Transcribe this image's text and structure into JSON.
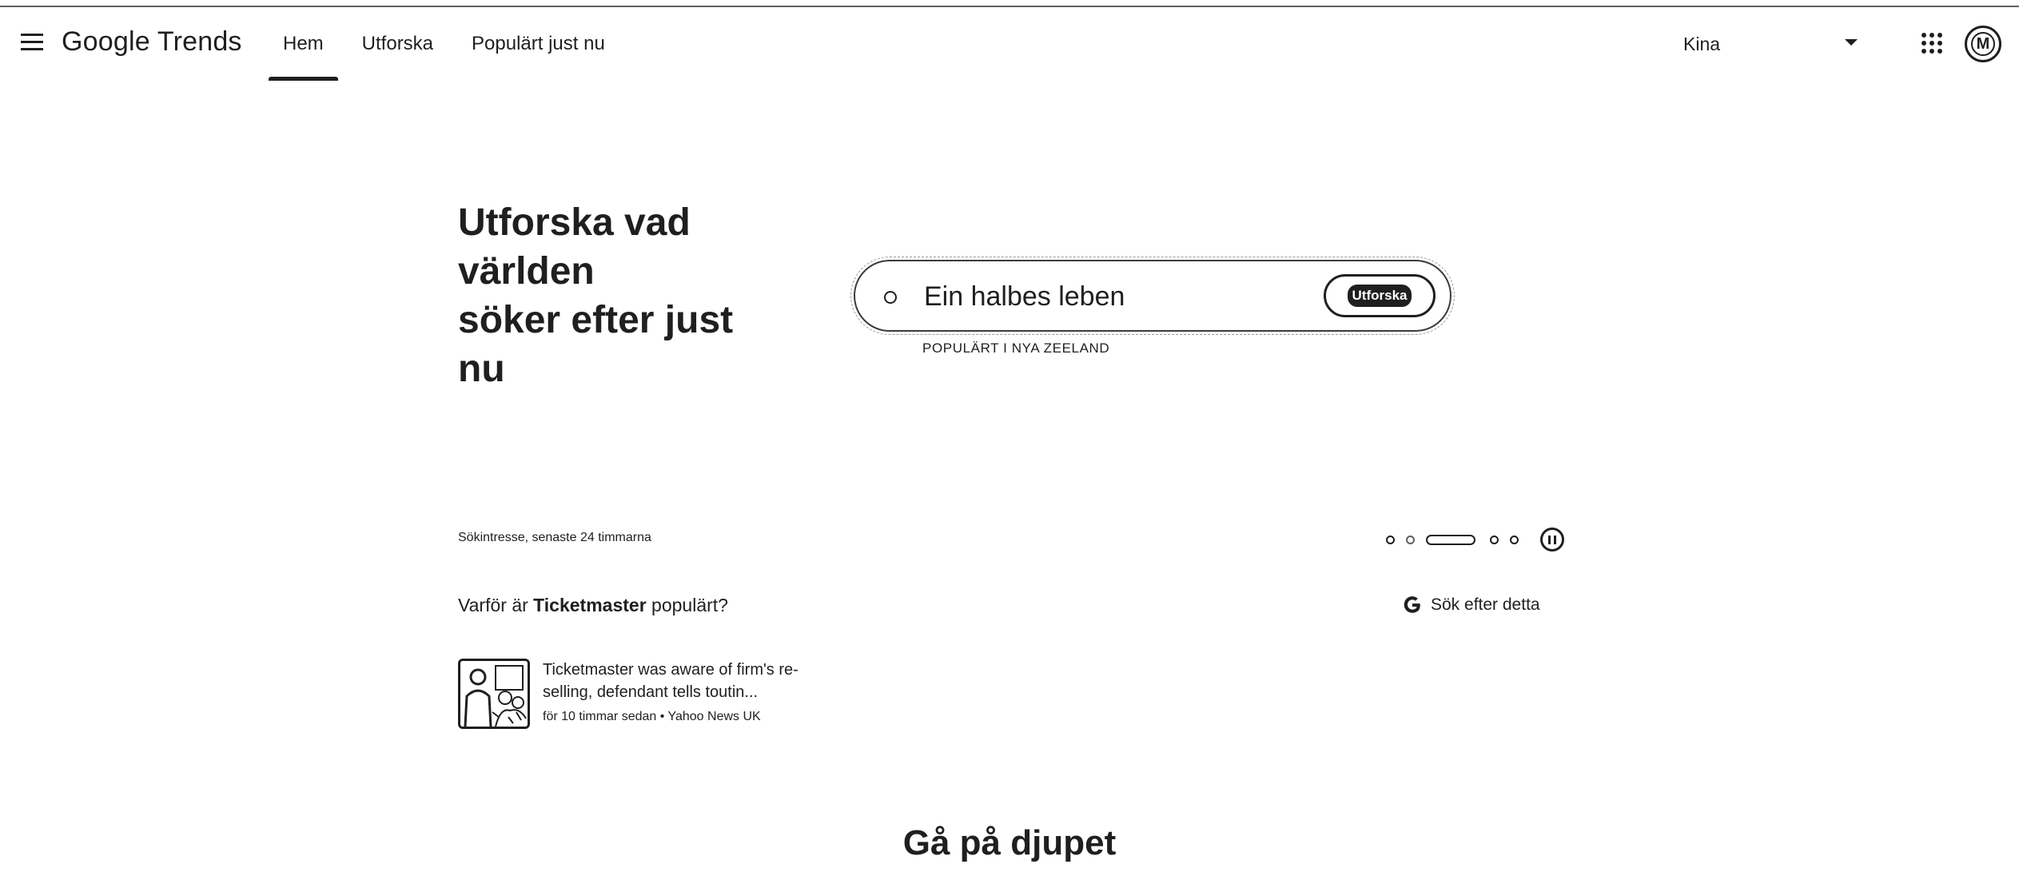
{
  "header": {
    "logo": "Google Trends",
    "tabs": [
      {
        "label": "Hem",
        "active": true
      },
      {
        "label": "Utforska",
        "active": false
      },
      {
        "label": "Populärt just nu",
        "active": false
      }
    ],
    "region": "Kina",
    "avatar_letter": "M",
    "icons": [
      "menu-icon",
      "apps-icon",
      "chevron-down-icon"
    ]
  },
  "hero": {
    "line1": "Utforska vad",
    "line2_bold": "världen",
    "line3": "söker efter just",
    "line4": "nu"
  },
  "search": {
    "value": "Ein halbes leben",
    "button_label": "Utforska",
    "trending_label": "POPULÄRT I NYA ZEELAND"
  },
  "interest": {
    "label": "Sökintresse, senaste 24 timmarna",
    "carousel_count": 5,
    "carousel_active": 3,
    "why_prefix": "Varför är ",
    "why_term": "Ticketmaster",
    "why_suffix": " populärt?",
    "search_this_label": "Sök efter detta"
  },
  "news": {
    "title": "Ticketmaster was aware of firm's re-selling, defendant tells toutin...",
    "meta": "för 10 timmar sedan • Yahoo News UK"
  },
  "section": {
    "deep_title": "Gå på djupet"
  }
}
